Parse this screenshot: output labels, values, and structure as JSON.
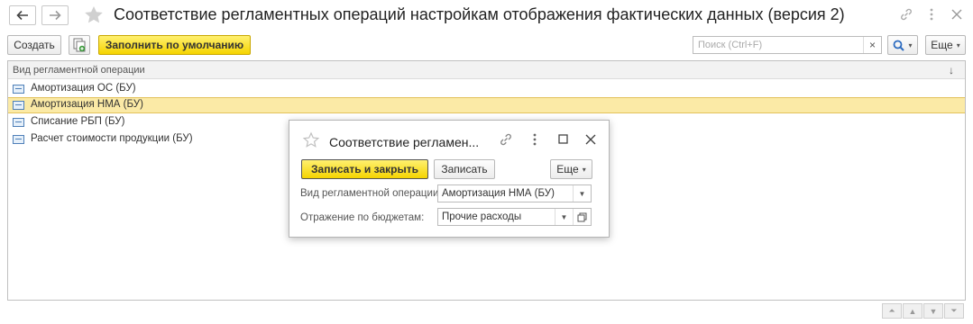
{
  "window": {
    "title": "Соответствие регламентных операций настройкам отображения фактических данных (версия 2)"
  },
  "toolbar": {
    "create_label": "Создать",
    "fill_default_label": "Заполнить по умолчанию",
    "search_placeholder": "Поиск (Ctrl+F)",
    "search_clear": "×",
    "more_label": "Еще"
  },
  "table": {
    "column_header": "Вид регламентной операции",
    "sort_indicator": "↓",
    "rows": [
      {
        "label": "Амортизация ОС (БУ)"
      },
      {
        "label": "Амортизация НМА (БУ)"
      },
      {
        "label": "Списание РБП (БУ)"
      },
      {
        "label": "Расчет стоимости продукции (БУ)"
      }
    ]
  },
  "dialog": {
    "title": "Соответствие регламен...",
    "save_close_label": "Записать и закрыть",
    "save_label": "Записать",
    "more_label": "Еще",
    "fields": [
      {
        "label": "Вид регламентной операции:",
        "value": "Амортизация НМА (БУ)"
      },
      {
        "label": "Отражение по бюджетам:",
        "value": "Прочие расходы"
      }
    ]
  },
  "colors": {
    "accent_yellow": "#f5d400",
    "selected_row": "#fbeaa6"
  }
}
